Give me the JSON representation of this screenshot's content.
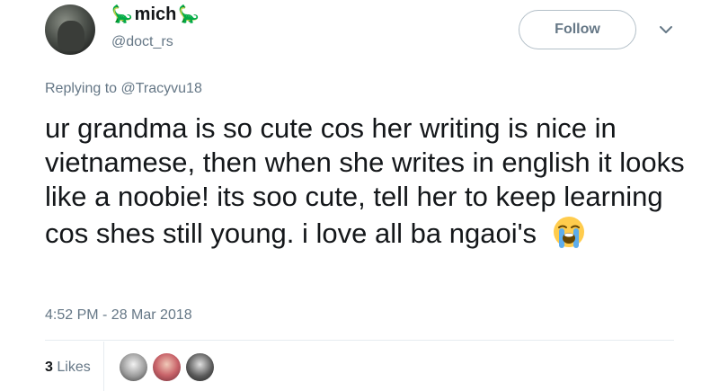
{
  "author": {
    "display_name": "mich",
    "handle": "@doct_rs",
    "name_emoji": "🦕"
  },
  "follow_label": "Follow",
  "reply": {
    "prefix": "Replying to ",
    "mention": "@Tracyvu18"
  },
  "tweet": {
    "text": "ur grandma is so cute cos her writing is nice in vietnamese, then when she writes in english it looks like a noobie! its soo cute, tell her to keep learning cos shes still young. i love all ba ngaoi's",
    "emoji_icon": "loudly-crying-face-icon"
  },
  "timestamp": "4:52 PM - 28 Mar 2018",
  "likes": {
    "count": "3",
    "label": "Likes"
  },
  "colors": {
    "text": "#14171a",
    "secondary": "#657786",
    "border": "#e6ecf0",
    "button_border": "#b3bfc8"
  }
}
